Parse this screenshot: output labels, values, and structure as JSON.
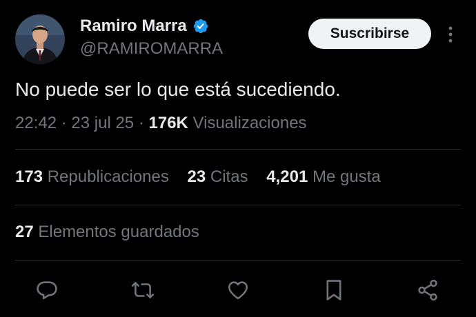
{
  "author": {
    "name": "Ramiro Marra",
    "handle": "@RAMIROMARRA",
    "verified": true
  },
  "subscribe_label": "Suscribirse",
  "tweet": {
    "text": "No puede ser lo que está sucediendo.",
    "time": "22:42",
    "date": "23 jul 25",
    "views": "176K",
    "views_label": "Visualizaciones",
    "separator": "·"
  },
  "stats": {
    "reposts": "173",
    "reposts_label": "Republicaciones",
    "quotes": "23",
    "quotes_label": "Citas",
    "likes": "4,201",
    "likes_label": "Me gusta",
    "bookmarks": "27",
    "bookmarks_label": "Elementos guardados"
  },
  "colors": {
    "background": "#000000",
    "text": "#e7e9ea",
    "muted": "#71767b",
    "verified": "#1d9bf0",
    "divider": "#2f3336"
  },
  "icons": [
    "verified-badge-icon",
    "more-options-icon",
    "reply-icon",
    "repost-icon",
    "like-icon",
    "bookmark-icon",
    "share-icon"
  ]
}
